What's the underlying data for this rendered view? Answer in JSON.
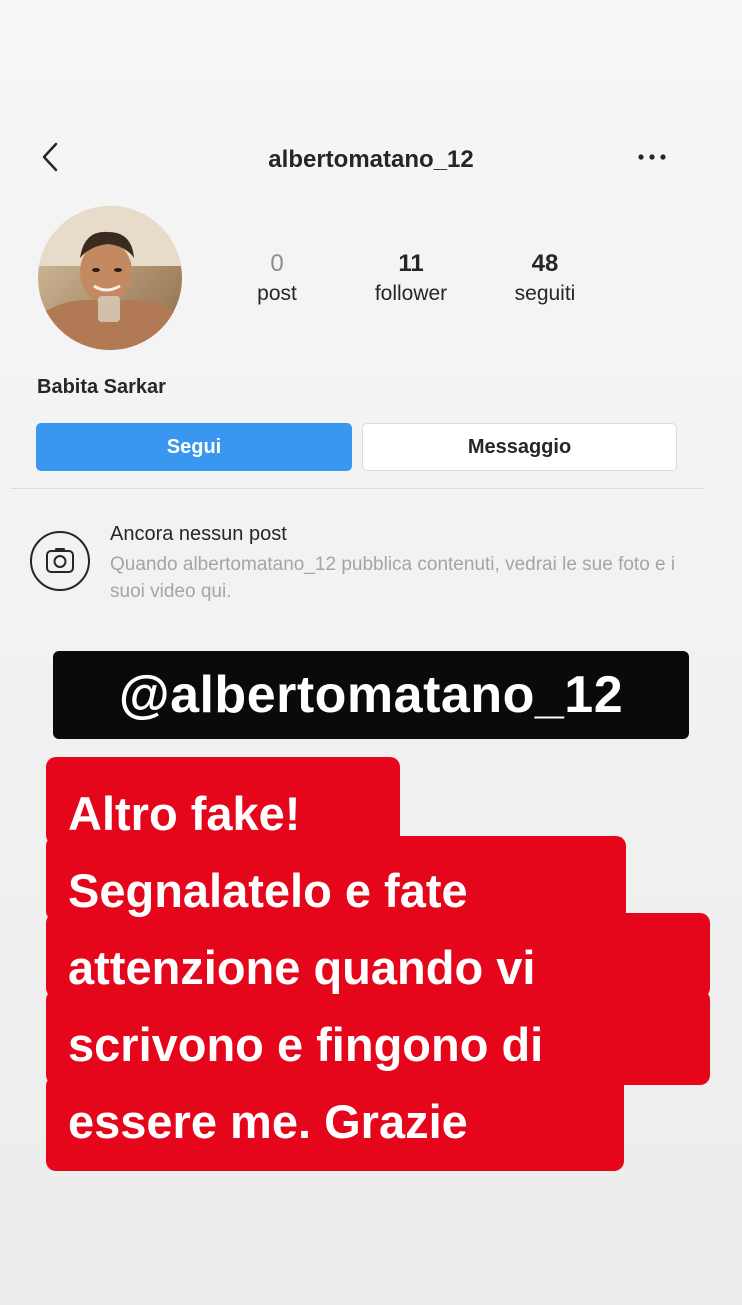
{
  "header": {
    "username": "albertomatano_12",
    "back_icon": "chevron-left-icon",
    "more_icon": "more-horizontal-icon"
  },
  "profile": {
    "stats": [
      {
        "value": "0",
        "label": "post"
      },
      {
        "value": "11",
        "label": "follower"
      },
      {
        "value": "48",
        "label": "seguiti"
      }
    ],
    "display_name": "Babita Sarkar",
    "follow_label": "Segui",
    "message_label": "Messaggio"
  },
  "empty_state": {
    "icon": "camera-icon",
    "title": "Ancora nessun post",
    "text": "Quando albertomatano_12 pubblica contenuti, vedrai le sue foto e i suoi video qui."
  },
  "overlay": {
    "handle": "@albertomatano_12",
    "message_lines": [
      "Altro fake!",
      "Segnalatelo e fate",
      "attenzione quando vi",
      "scrivono e fingono di",
      "essere me. Grazie"
    ],
    "colors": {
      "handle_bg": "#0a0a0a",
      "message_bg": "#e5061b",
      "follow_button": "#3a97f0"
    }
  }
}
